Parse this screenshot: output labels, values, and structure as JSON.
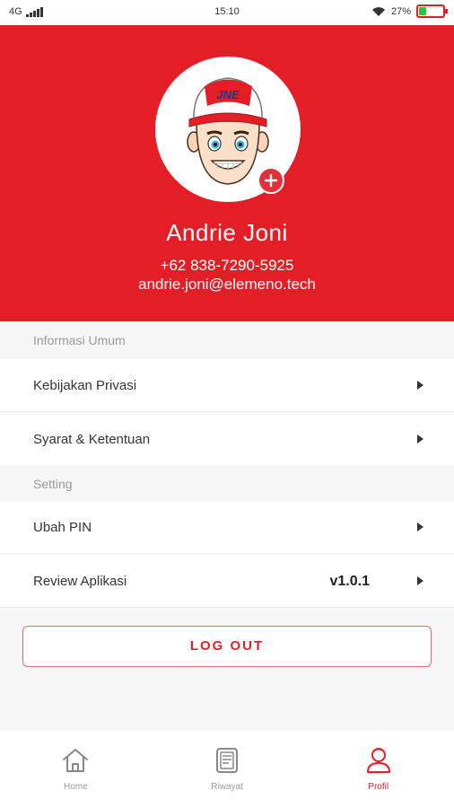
{
  "status_bar": {
    "network": "4G",
    "time": "15:10",
    "battery_percent": "27%",
    "battery_level": 0.27,
    "icons": [
      "signal-icon",
      "wifi-icon",
      "battery-icon"
    ]
  },
  "profile": {
    "name": "Andrie Joni",
    "phone": "+62 838-7290-5925",
    "email": "andrie.joni@elemeno.tech",
    "avatar_cap_text": "JNE",
    "add_icon": "plus-icon"
  },
  "sections": {
    "general": {
      "label": "Informasi Umum",
      "items": [
        {
          "label": "Kebijakan Privasi"
        },
        {
          "label": "Syarat & Ketentuan"
        }
      ]
    },
    "setting": {
      "label": "Setting",
      "items": [
        {
          "label": "Ubah PIN"
        },
        {
          "label": "Review Aplikasi",
          "value": "v1.0.1"
        }
      ]
    }
  },
  "logout_label": "LOG OUT",
  "bottom_nav": {
    "items": [
      {
        "label": "Home",
        "icon": "home-icon"
      },
      {
        "label": "Riwayat",
        "icon": "history-icon"
      },
      {
        "label": "Profil",
        "icon": "profile-icon"
      }
    ],
    "active": "Profil"
  },
  "colors": {
    "brand_red": "#e41e26",
    "battery_green": "#30c33f",
    "inactive_gray": "#9a9a9a"
  }
}
